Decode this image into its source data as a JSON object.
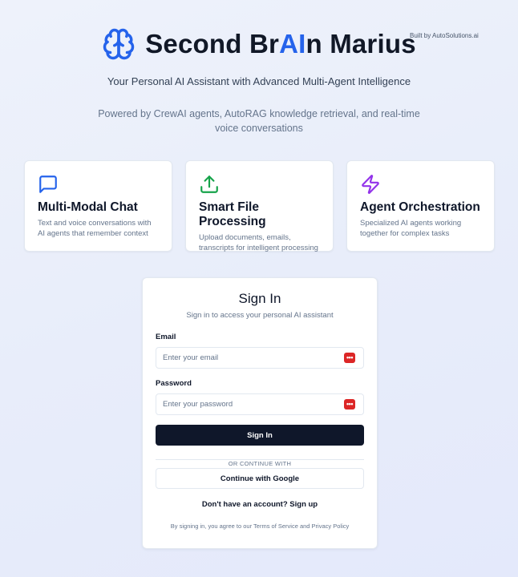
{
  "header": {
    "title_before": "Second Br",
    "title_accent": "AI",
    "title_after": "n Marius",
    "built_by": "Built by AutoSolutions.ai",
    "icon": "brain-icon",
    "accent_color": "#2563eb"
  },
  "tagline": "Your Personal AI Assistant with Advanced Multi-Agent Intelligence",
  "powered_by": "Powered by CrewAI agents, AutoRAG knowledge retrieval, and real-time voice conversations",
  "features": [
    {
      "title": "Multi-Modal Chat",
      "description": "Text and voice conversations with AI agents that remember context",
      "icon": "chat-bubble-icon",
      "color": "#2563eb"
    },
    {
      "title": "Smart File Processing",
      "description": "Upload documents, emails, transcripts for intelligent processing",
      "icon": "upload-icon",
      "color": "#16a34a"
    },
    {
      "title": "Agent Orchestration",
      "description": "Specialized AI agents working together for complex tasks",
      "icon": "lightning-icon",
      "color": "#9333ea"
    }
  ],
  "signin": {
    "title": "Sign In",
    "subtitle": "Sign in to access your personal AI assistant",
    "email_label": "Email",
    "email_placeholder": "Enter your email",
    "email_value": "",
    "password_label": "Password",
    "password_placeholder": "Enter your password",
    "password_value": "",
    "password_manager_icon": "password-manager-icon",
    "password_manager_glyph": "•••",
    "submit_label": "Sign In",
    "divider_text": "OR CONTINUE WITH",
    "google_label": "Continue with Google",
    "signup_text": "Don't have an account? Sign up",
    "terms_text": "By signing in, you agree to our Terms of Service and Privacy Policy"
  }
}
